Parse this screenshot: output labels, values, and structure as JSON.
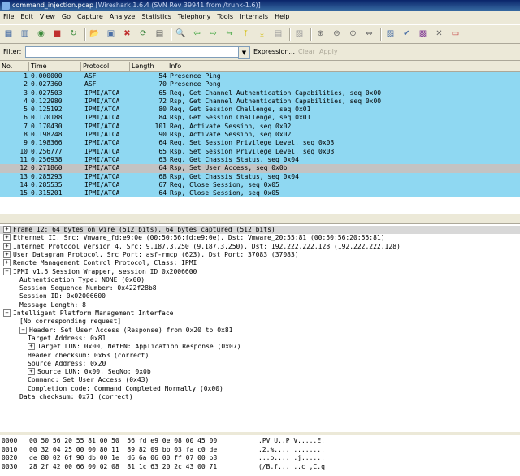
{
  "title": {
    "file": "command_injection.pcap",
    "app": "[Wireshark 1.6.4  (SVN Rev 39941 from /trunk-1.6)]"
  },
  "menu": [
    "File",
    "Edit",
    "View",
    "Go",
    "Capture",
    "Analyze",
    "Statistics",
    "Telephony",
    "Tools",
    "Internals",
    "Help"
  ],
  "toolbar": {
    "icons": [
      "interface-list-icon",
      "capture-options-icon",
      "start-capture-icon",
      "stop-capture-icon",
      "restart-capture-icon",
      "open-file-icon",
      "save-file-icon",
      "close-file-icon",
      "reload-icon",
      "print-icon",
      "find-packet-icon",
      "go-back-icon",
      "go-forward-icon",
      "go-to-packet-icon",
      "go-first-icon",
      "go-last-icon",
      "colorize-icon",
      "auto-scroll-icon",
      "zoom-in-icon",
      "zoom-out-icon",
      "normal-size-icon",
      "resize-columns-icon",
      "capture-filters-icon",
      "display-filters-icon",
      "coloring-rules-icon",
      "preferences-icon",
      "help-icon"
    ]
  },
  "filter": {
    "label": "Filter:",
    "value": "",
    "expression": "Expression...",
    "clear": "Clear",
    "apply": "Apply"
  },
  "columns": [
    "No.",
    "Time",
    "Protocol",
    "Length",
    "Info"
  ],
  "packets": [
    {
      "no": "1",
      "time": "0.000000",
      "proto": "ASF",
      "len": "54",
      "info": "Presence Ping"
    },
    {
      "no": "2",
      "time": "0.027360",
      "proto": "ASF",
      "len": "70",
      "info": "Presence Pong"
    },
    {
      "no": "3",
      "time": "0.027503",
      "proto": "IPMI/ATCA",
      "len": "65",
      "info": "Req, Get Channel Authentication Capabilities, seq 0x00"
    },
    {
      "no": "4",
      "time": "0.122980",
      "proto": "IPMI/ATCA",
      "len": "72",
      "info": "Rsp, Get Channel Authentication Capabilities, seq 0x00"
    },
    {
      "no": "5",
      "time": "0.125192",
      "proto": "IPMI/ATCA",
      "len": "80",
      "info": "Req, Get Session Challenge, seq 0x01"
    },
    {
      "no": "6",
      "time": "0.170188",
      "proto": "IPMI/ATCA",
      "len": "84",
      "info": "Rsp, Get Session Challenge, seq 0x01"
    },
    {
      "no": "7",
      "time": "0.170430",
      "proto": "IPMI/ATCA",
      "len": "101",
      "info": "Req, Activate Session, seq 0x02"
    },
    {
      "no": "8",
      "time": "0.198248",
      "proto": "IPMI/ATCA",
      "len": "90",
      "info": "Rsp, Activate Session, seq 0x02"
    },
    {
      "no": "9",
      "time": "0.198366",
      "proto": "IPMI/ATCA",
      "len": "64",
      "info": "Req, Set Session Privilege Level, seq 0x03"
    },
    {
      "no": "10",
      "time": "0.256777",
      "proto": "IPMI/ATCA",
      "len": "65",
      "info": "Rsp, Set Session Privilege Level, seq 0x03"
    },
    {
      "no": "11",
      "time": "0.256938",
      "proto": "IPMI/ATCA",
      "len": "63",
      "info": "Req, Get Chassis Status, seq 0x04"
    },
    {
      "no": "12",
      "time": "0.271860",
      "proto": "IPMI/ATCA",
      "len": "64",
      "info": "Rsp, Set User Access, seq 0x0b"
    },
    {
      "no": "13",
      "time": "0.285293",
      "proto": "IPMI/ATCA",
      "len": "68",
      "info": "Rsp, Get Chassis Status, seq 0x04"
    },
    {
      "no": "14",
      "time": "0.285535",
      "proto": "IPMI/ATCA",
      "len": "67",
      "info": "Req, Close Session, seq 0x05"
    },
    {
      "no": "15",
      "time": "0.315201",
      "proto": "IPMI/ATCA",
      "len": "64",
      "info": "Rsp, Close Session, seq 0x05"
    }
  ],
  "details": [
    {
      "text": "Frame 12: 64 bytes on wire (512 bits), 64 bytes captured (512 bits)",
      "exp": "+",
      "indent": 0,
      "hl": true
    },
    {
      "text": "Ethernet II, Src: Vmware_fd:e9:0e (00:50:56:fd:e9:0e), Dst: Vmware_20:55:81 (00:50:56:20:55:81)",
      "exp": "+",
      "indent": 0,
      "hl": false
    },
    {
      "text": "Internet Protocol Version 4, Src: 9.187.3.250 (9.187.3.250), Dst: 192.222.222.128 (192.222.222.128)",
      "exp": "+",
      "indent": 0,
      "hl": false
    },
    {
      "text": "User Datagram Protocol, Src Port: asf-rmcp (623), Dst Port: 37083 (37083)",
      "exp": "+",
      "indent": 0,
      "hl": false
    },
    {
      "text": "Remote Management Control Protocol, Class: IPMI",
      "exp": "+",
      "indent": 0,
      "hl": false
    },
    {
      "text": "IPMI v1.5 Session Wrapper, session ID 0x2006600",
      "exp": "-",
      "indent": 0,
      "hl": false
    },
    {
      "text": "Authentication Type: NONE (0x00)",
      "exp": "",
      "indent": 1,
      "hl": false
    },
    {
      "text": "Session Sequence Number: 0x422f28b8",
      "exp": "",
      "indent": 1,
      "hl": false
    },
    {
      "text": "Session ID: 0x02006600",
      "exp": "",
      "indent": 1,
      "hl": false
    },
    {
      "text": "Message Length: 8",
      "exp": "",
      "indent": 1,
      "hl": false
    },
    {
      "text": "Intelligent Platform Management Interface",
      "exp": "-",
      "indent": 0,
      "hl": false
    },
    {
      "text": "[No corresponding request]",
      "exp": "",
      "indent": 1,
      "hl": false
    },
    {
      "text": "Header: Set User Access (Response) from 0x20 to 0x81",
      "exp": "-",
      "indent": 1,
      "hl": false
    },
    {
      "text": "Target Address: 0x81",
      "exp": "",
      "indent": 2,
      "hl": false
    },
    {
      "text": "Target LUN: 0x00, NetFN: Application Response (0x07)",
      "exp": "+",
      "indent": 2,
      "hl": false
    },
    {
      "text": "Header checksum: 0x63 (correct)",
      "exp": "",
      "indent": 2,
      "hl": false
    },
    {
      "text": "Source Address: 0x20",
      "exp": "",
      "indent": 2,
      "hl": false
    },
    {
      "text": "Source LUN: 0x00, SeqNo: 0x0b",
      "exp": "+",
      "indent": 2,
      "hl": false
    },
    {
      "text": "Command: Set User Access (0x43)",
      "exp": "",
      "indent": 2,
      "hl": false
    },
    {
      "text": "Completion code: Command Completed Normally (0x00)",
      "exp": "",
      "indent": 2,
      "hl": false
    },
    {
      "text": "Data checksum: 0x71 (correct)",
      "exp": "",
      "indent": 1,
      "hl": false
    }
  ],
  "hex": [
    {
      "off": "0000",
      "bytes": "00 50 56 20 55 81 00 50  56 fd e9 0e 08 00 45 00",
      "ascii": ".PV U..P V.....E."
    },
    {
      "off": "0010",
      "bytes": "00 32 04 25 00 00 80 11  89 82 09 bb 03 fa c0 de",
      "ascii": ".2.%.... ........"
    },
    {
      "off": "0020",
      "bytes": "de 80 02 6f 90 db 00 1e  d6 6a 06 00 ff 07 00 b8",
      "ascii": "...o.... .j......"
    },
    {
      "off": "0030",
      "bytes": "28 2f 42 00 66 00 02 08  81 1c 63 20 2c 43 00 71",
      "ascii": "(/B.f... ..c ,C.q"
    }
  ],
  "selected_packet": "12"
}
